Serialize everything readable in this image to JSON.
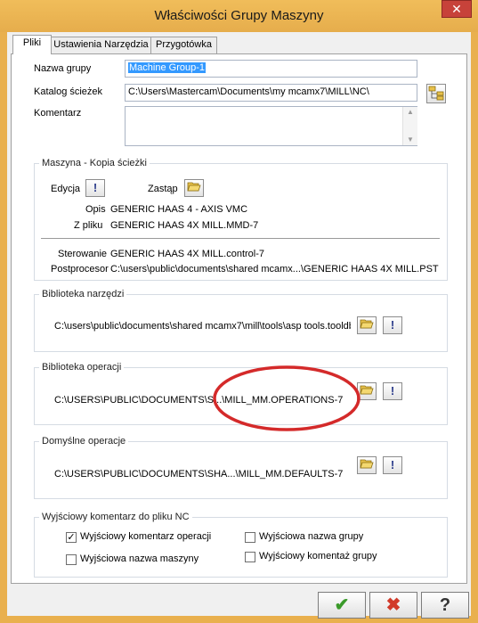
{
  "window": {
    "title": "Właściwości Grupy Maszyny",
    "close": "✕"
  },
  "tabs": [
    "Pliki",
    "Ustawienia Narzędzia",
    "Przygotówka"
  ],
  "fields": {
    "group_name_label": "Nazwa grupy",
    "group_name_value": "Machine Group-1",
    "path_label": "Katalog ścieżek",
    "path_value": "C:\\Users\\Mastercam\\Documents\\my mcamx7\\MILL\\NC\\",
    "comment_label": "Komentarz",
    "comment_value": ""
  },
  "machine": {
    "title": "Maszyna - Kopia ścieżki",
    "edit_label": "Edycja",
    "replace_label": "Zastąp",
    "desc_label": "Opis",
    "desc_value": "GENERIC HAAS 4 - AXIS VMC",
    "file_label": "Z pliku",
    "file_value": "GENERIC HAAS 4X MILL.MMD-7",
    "control_label": "Sterowanie",
    "control_value": "GENERIC HAAS 4X MILL.control-7",
    "post_label": "Postprocesor",
    "post_value": "C:\\users\\public\\documents\\shared mcamx...\\GENERIC HAAS 4X MILL.PST"
  },
  "tool_library": {
    "title": "Biblioteka narzędzi",
    "path": "C:\\users\\public\\documents\\shared mcamx7\\mill\\tools\\asp tools.tooldb"
  },
  "ops_library": {
    "title": "Biblioteka operacji",
    "path": "C:\\USERS\\PUBLIC\\DOCUMENTS\\S...\\MILL_MM.OPERATIONS-7"
  },
  "default_ops": {
    "title": "Domyślne operacje",
    "path": "C:\\USERS\\PUBLIC\\DOCUMENTS\\SHA...\\MILL_MM.DEFAULTS-7"
  },
  "nc_comments": {
    "title": "Wyjściowy komentarz do pliku NC",
    "op_comment": {
      "label": "Wyjściowy komentarz operacji",
      "checked": true
    },
    "group_name": {
      "label": "Wyjściowa nazwa grupy",
      "checked": false
    },
    "machine_name": {
      "label": "Wyjściowa nazwa maszyny",
      "checked": false
    },
    "group_comment": {
      "label": "Wyjściowy komentaż grupy",
      "checked": false
    }
  },
  "buttons": {
    "ok": "✔",
    "cancel": "✖",
    "help": "?"
  },
  "colors": {
    "accent_frame": "#e9b04e",
    "ok_green": "#3a9a2a",
    "cancel_red": "#d13a2a",
    "annotation_red": "#d42a2a"
  }
}
